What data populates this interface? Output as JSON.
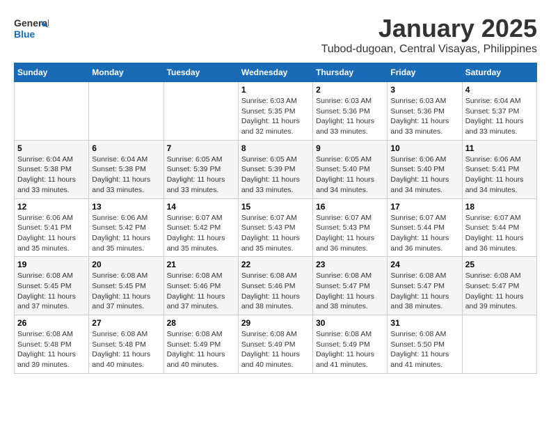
{
  "header": {
    "logo_general": "General",
    "logo_blue": "Blue",
    "month_title": "January 2025",
    "location": "Tubod-dugoan, Central Visayas, Philippines"
  },
  "weekdays": [
    "Sunday",
    "Monday",
    "Tuesday",
    "Wednesday",
    "Thursday",
    "Friday",
    "Saturday"
  ],
  "weeks": [
    [
      {
        "day": "",
        "sunrise": "",
        "sunset": "",
        "daylight": ""
      },
      {
        "day": "",
        "sunrise": "",
        "sunset": "",
        "daylight": ""
      },
      {
        "day": "",
        "sunrise": "",
        "sunset": "",
        "daylight": ""
      },
      {
        "day": "1",
        "sunrise": "Sunrise: 6:03 AM",
        "sunset": "Sunset: 5:35 PM",
        "daylight": "Daylight: 11 hours and 32 minutes."
      },
      {
        "day": "2",
        "sunrise": "Sunrise: 6:03 AM",
        "sunset": "Sunset: 5:36 PM",
        "daylight": "Daylight: 11 hours and 33 minutes."
      },
      {
        "day": "3",
        "sunrise": "Sunrise: 6:03 AM",
        "sunset": "Sunset: 5:36 PM",
        "daylight": "Daylight: 11 hours and 33 minutes."
      },
      {
        "day": "4",
        "sunrise": "Sunrise: 6:04 AM",
        "sunset": "Sunset: 5:37 PM",
        "daylight": "Daylight: 11 hours and 33 minutes."
      }
    ],
    [
      {
        "day": "5",
        "sunrise": "Sunrise: 6:04 AM",
        "sunset": "Sunset: 5:38 PM",
        "daylight": "Daylight: 11 hours and 33 minutes."
      },
      {
        "day": "6",
        "sunrise": "Sunrise: 6:04 AM",
        "sunset": "Sunset: 5:38 PM",
        "daylight": "Daylight: 11 hours and 33 minutes."
      },
      {
        "day": "7",
        "sunrise": "Sunrise: 6:05 AM",
        "sunset": "Sunset: 5:39 PM",
        "daylight": "Daylight: 11 hours and 33 minutes."
      },
      {
        "day": "8",
        "sunrise": "Sunrise: 6:05 AM",
        "sunset": "Sunset: 5:39 PM",
        "daylight": "Daylight: 11 hours and 33 minutes."
      },
      {
        "day": "9",
        "sunrise": "Sunrise: 6:05 AM",
        "sunset": "Sunset: 5:40 PM",
        "daylight": "Daylight: 11 hours and 34 minutes."
      },
      {
        "day": "10",
        "sunrise": "Sunrise: 6:06 AM",
        "sunset": "Sunset: 5:40 PM",
        "daylight": "Daylight: 11 hours and 34 minutes."
      },
      {
        "day": "11",
        "sunrise": "Sunrise: 6:06 AM",
        "sunset": "Sunset: 5:41 PM",
        "daylight": "Daylight: 11 hours and 34 minutes."
      }
    ],
    [
      {
        "day": "12",
        "sunrise": "Sunrise: 6:06 AM",
        "sunset": "Sunset: 5:41 PM",
        "daylight": "Daylight: 11 hours and 35 minutes."
      },
      {
        "day": "13",
        "sunrise": "Sunrise: 6:06 AM",
        "sunset": "Sunset: 5:42 PM",
        "daylight": "Daylight: 11 hours and 35 minutes."
      },
      {
        "day": "14",
        "sunrise": "Sunrise: 6:07 AM",
        "sunset": "Sunset: 5:42 PM",
        "daylight": "Daylight: 11 hours and 35 minutes."
      },
      {
        "day": "15",
        "sunrise": "Sunrise: 6:07 AM",
        "sunset": "Sunset: 5:43 PM",
        "daylight": "Daylight: 11 hours and 35 minutes."
      },
      {
        "day": "16",
        "sunrise": "Sunrise: 6:07 AM",
        "sunset": "Sunset: 5:43 PM",
        "daylight": "Daylight: 11 hours and 36 minutes."
      },
      {
        "day": "17",
        "sunrise": "Sunrise: 6:07 AM",
        "sunset": "Sunset: 5:44 PM",
        "daylight": "Daylight: 11 hours and 36 minutes."
      },
      {
        "day": "18",
        "sunrise": "Sunrise: 6:07 AM",
        "sunset": "Sunset: 5:44 PM",
        "daylight": "Daylight: 11 hours and 36 minutes."
      }
    ],
    [
      {
        "day": "19",
        "sunrise": "Sunrise: 6:08 AM",
        "sunset": "Sunset: 5:45 PM",
        "daylight": "Daylight: 11 hours and 37 minutes."
      },
      {
        "day": "20",
        "sunrise": "Sunrise: 6:08 AM",
        "sunset": "Sunset: 5:45 PM",
        "daylight": "Daylight: 11 hours and 37 minutes."
      },
      {
        "day": "21",
        "sunrise": "Sunrise: 6:08 AM",
        "sunset": "Sunset: 5:46 PM",
        "daylight": "Daylight: 11 hours and 37 minutes."
      },
      {
        "day": "22",
        "sunrise": "Sunrise: 6:08 AM",
        "sunset": "Sunset: 5:46 PM",
        "daylight": "Daylight: 11 hours and 38 minutes."
      },
      {
        "day": "23",
        "sunrise": "Sunrise: 6:08 AM",
        "sunset": "Sunset: 5:47 PM",
        "daylight": "Daylight: 11 hours and 38 minutes."
      },
      {
        "day": "24",
        "sunrise": "Sunrise: 6:08 AM",
        "sunset": "Sunset: 5:47 PM",
        "daylight": "Daylight: 11 hours and 38 minutes."
      },
      {
        "day": "25",
        "sunrise": "Sunrise: 6:08 AM",
        "sunset": "Sunset: 5:47 PM",
        "daylight": "Daylight: 11 hours and 39 minutes."
      }
    ],
    [
      {
        "day": "26",
        "sunrise": "Sunrise: 6:08 AM",
        "sunset": "Sunset: 5:48 PM",
        "daylight": "Daylight: 11 hours and 39 minutes."
      },
      {
        "day": "27",
        "sunrise": "Sunrise: 6:08 AM",
        "sunset": "Sunset: 5:48 PM",
        "daylight": "Daylight: 11 hours and 40 minutes."
      },
      {
        "day": "28",
        "sunrise": "Sunrise: 6:08 AM",
        "sunset": "Sunset: 5:49 PM",
        "daylight": "Daylight: 11 hours and 40 minutes."
      },
      {
        "day": "29",
        "sunrise": "Sunrise: 6:08 AM",
        "sunset": "Sunset: 5:49 PM",
        "daylight": "Daylight: 11 hours and 40 minutes."
      },
      {
        "day": "30",
        "sunrise": "Sunrise: 6:08 AM",
        "sunset": "Sunset: 5:49 PM",
        "daylight": "Daylight: 11 hours and 41 minutes."
      },
      {
        "day": "31",
        "sunrise": "Sunrise: 6:08 AM",
        "sunset": "Sunset: 5:50 PM",
        "daylight": "Daylight: 11 hours and 41 minutes."
      },
      {
        "day": "",
        "sunrise": "",
        "sunset": "",
        "daylight": ""
      }
    ]
  ]
}
